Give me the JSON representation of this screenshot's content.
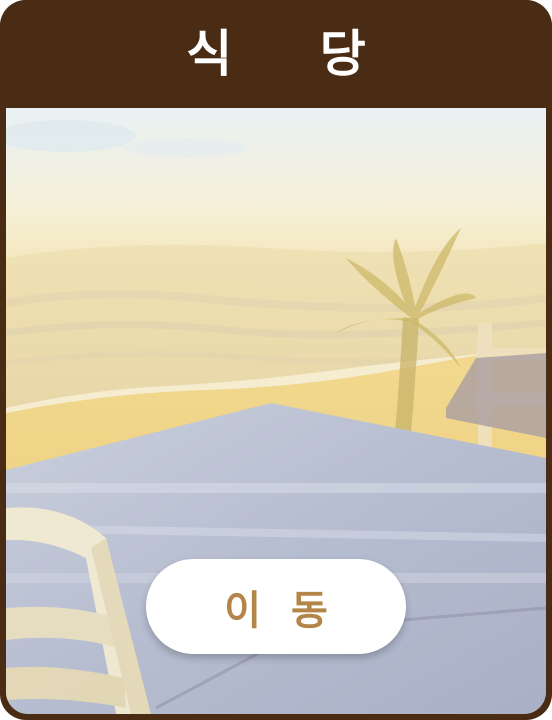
{
  "header": {
    "title": "식 당"
  },
  "scene": {
    "description_icon": "beach-restaurant-illustration"
  },
  "actions": {
    "move_label": "이 동"
  },
  "colors": {
    "header_bg": "#4a2b14",
    "header_text": "#ffffff",
    "button_bg": "#ffffff",
    "button_text": "#b48548"
  }
}
